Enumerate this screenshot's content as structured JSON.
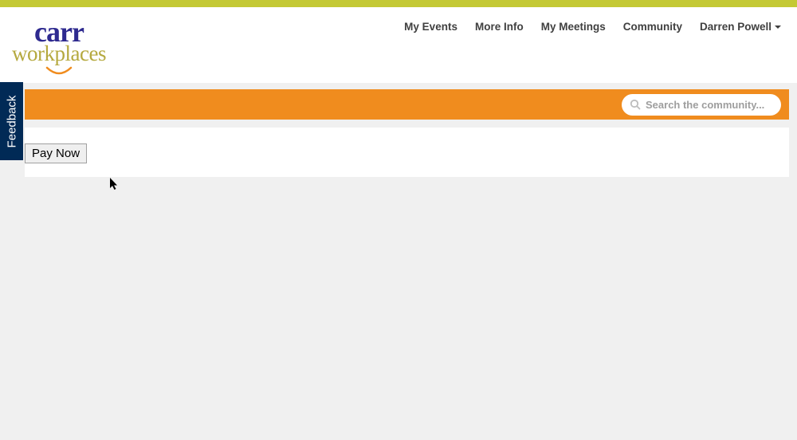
{
  "logo": {
    "line1": "carr",
    "line2": "workplaces"
  },
  "nav": {
    "items": [
      {
        "label": "My Events"
      },
      {
        "label": "More Info"
      },
      {
        "label": "My Meetings"
      },
      {
        "label": "Community"
      },
      {
        "label": "Darren Powell",
        "hasDropdown": true
      }
    ]
  },
  "search": {
    "placeholder": "Search the community..."
  },
  "actions": {
    "pay_now_label": "Pay Now"
  },
  "feedback": {
    "label": "Feedback"
  }
}
